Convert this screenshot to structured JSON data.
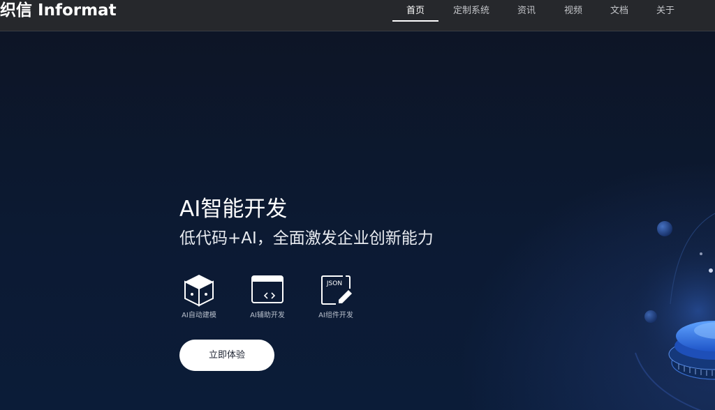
{
  "header": {
    "logo_text": "织信 Informat",
    "nav": [
      {
        "label": "首页",
        "active": true
      },
      {
        "label": "定制系统",
        "active": false
      },
      {
        "label": "资讯",
        "active": false
      },
      {
        "label": "视频",
        "active": false
      },
      {
        "label": "文档",
        "active": false
      },
      {
        "label": "关于",
        "active": false
      }
    ]
  },
  "hero": {
    "title": "AI智能开发",
    "subtitle": "低代码+AI，全面激发企业创新能力",
    "features": [
      {
        "label": "AI自动建模",
        "icon": "cube-icon"
      },
      {
        "label": "AI辅助开发",
        "icon": "code-window-icon"
      },
      {
        "label": "AI组件开发",
        "icon": "json-edit-icon"
      }
    ],
    "json_icon_text": "JSON",
    "cta_label": "立即体验"
  },
  "colors": {
    "topbar": "#26282c",
    "hero_bg": "#0c1a33",
    "accent_blue": "#3b7be0",
    "cta_bg": "#ffffff"
  }
}
